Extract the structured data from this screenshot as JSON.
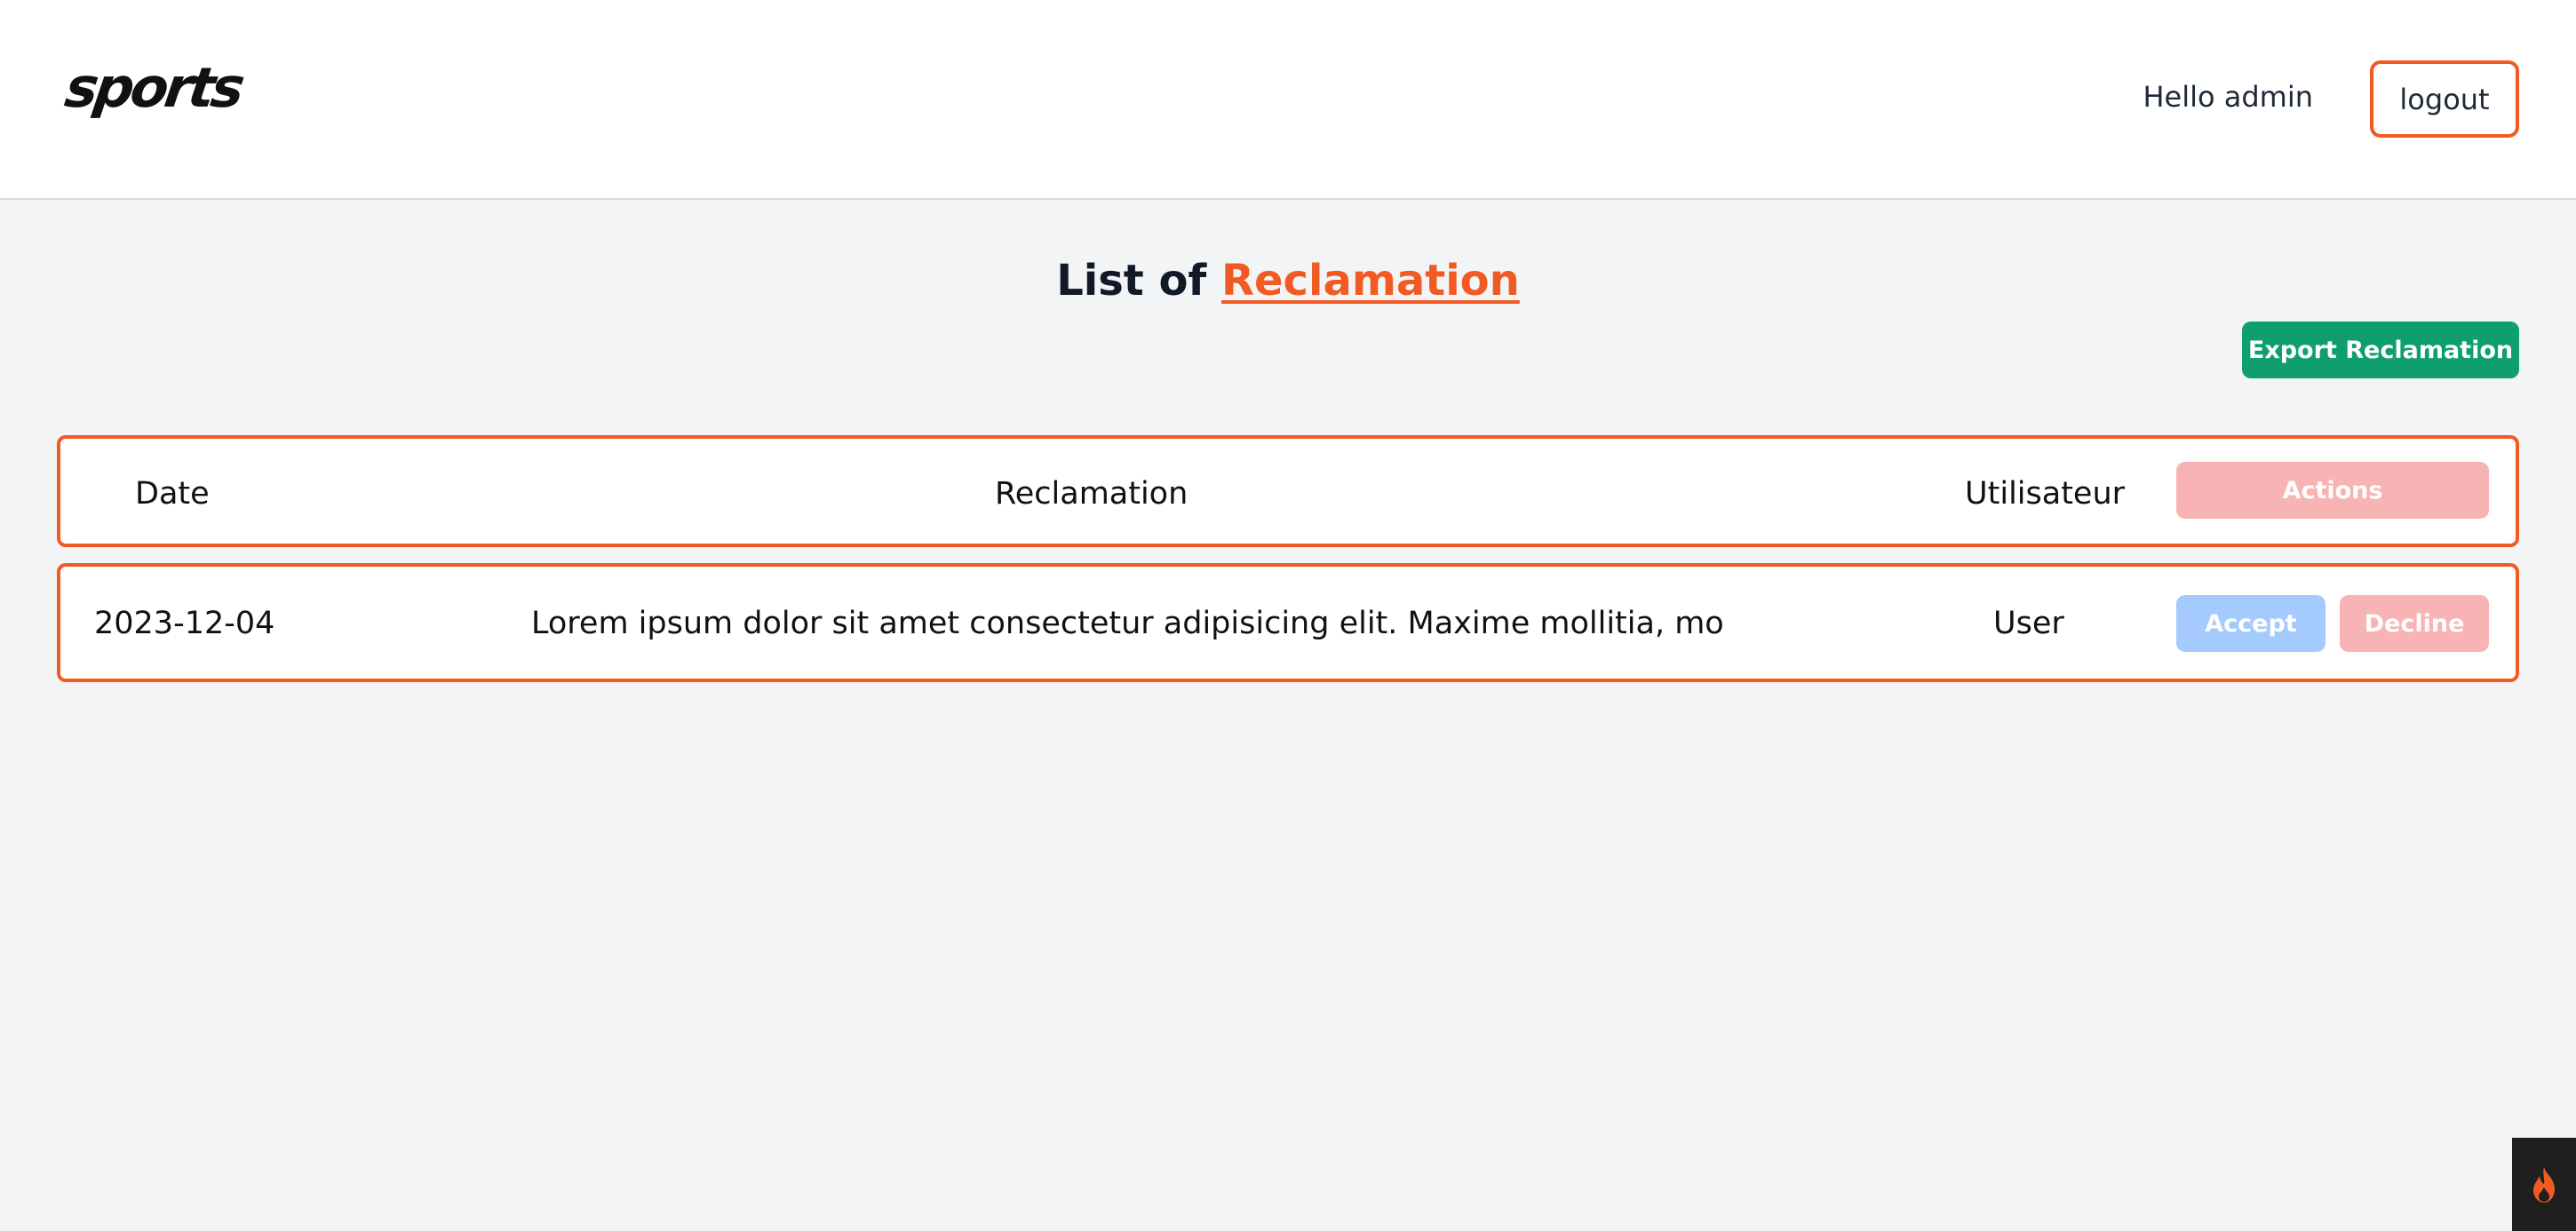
{
  "header": {
    "logo_text": "sports",
    "greeting": "Hello admin",
    "logout_label": "logout"
  },
  "main": {
    "title_prefix": "List of ",
    "title_accent": "Reclamation",
    "export_label": "Export Reclamation",
    "table": {
      "columns": {
        "date": "Date",
        "reclamation": "Reclamation",
        "user": "Utilisateur",
        "actions": "Actions"
      },
      "rows": [
        {
          "date": "2023-12-04",
          "reclamation": "Lorem ipsum dolor sit amet consectetur adipisicing elit. Maxime mollitia, mo",
          "user": "User",
          "accept_label": "Accept",
          "decline_label": "Decline"
        }
      ]
    }
  },
  "colors": {
    "accent": "#f15a22",
    "export_green": "#0f9f6e",
    "accept_blue": "#a4cafe",
    "decline_red": "#f8b4b4"
  },
  "icons": {
    "corner_widget": "flame-icon"
  }
}
